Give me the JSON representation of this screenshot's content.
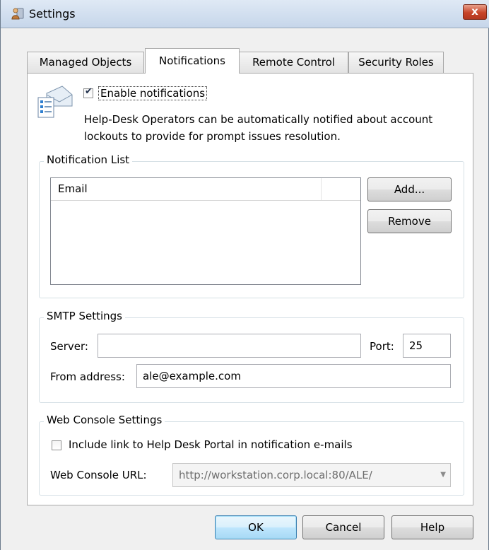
{
  "window": {
    "title": "Settings",
    "close_symbol": "x"
  },
  "tabs": [
    {
      "label": "Managed Objects",
      "active": false
    },
    {
      "label": "Notifications",
      "active": true
    },
    {
      "label": "Remote Control",
      "active": false
    },
    {
      "label": "Security Roles",
      "active": false
    }
  ],
  "notifications": {
    "icon": "notification-envelope-icon",
    "enable_label": "Enable notifications",
    "enable_checked": true,
    "description": "Help-Desk Operators can be automatically notified about account lockouts to provide for prompt issues resolution."
  },
  "notification_list": {
    "group_title": "Notification List",
    "column_header": "Email",
    "rows": [],
    "add_label": "Add...",
    "remove_label": "Remove"
  },
  "smtp": {
    "group_title": "SMTP Settings",
    "server_label": "Server:",
    "server_value": "",
    "port_label": "Port:",
    "port_value": "25",
    "from_label": "From address:",
    "from_value": "ale@example.com"
  },
  "web_console": {
    "group_title": "Web Console Settings",
    "include_link_label": "Include link to Help Desk Portal in notification e-mails",
    "include_link_checked": false,
    "url_label": "Web Console URL:",
    "url_value": "http://workstation.corp.local:80/ALE/"
  },
  "footer": {
    "ok_label": "OK",
    "cancel_label": "Cancel",
    "help_label": "Help"
  }
}
